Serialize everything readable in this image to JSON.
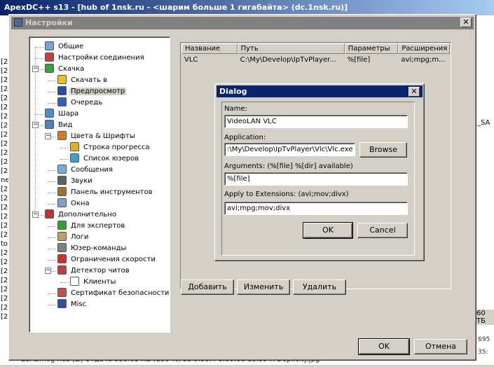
{
  "background": {
    "title": "ApexDC++ s13 - [hub of 1nsk.ru - <шарим больше 1 гигабайта> (dc.1nsk.ru)]",
    "left_marks": [
      "[2",
      "[2",
      "[2",
      "[2",
      "[2",
      "[2",
      "[2",
      "[2",
      "[2",
      "[2",
      "[2",
      "[2",
      "[2",
      "ne",
      "[2",
      "[2",
      "[2",
      "[2",
      "[2",
      "[2",
      "to",
      "[2",
      "[2",
      "[2",
      "[2",
      "[2",
      "[2",
      "[2",
      "[2"
    ],
    "right_label": "_SA",
    "right_number": "60 ТБ",
    "right_counts": [
      "695",
      "35:",
      "85"
    ],
    "bottom_text": "E3ASmog    hub    [Z] Отдача 959.05 КБ (100 %) за 0:00:4    0:00:00    18.99 К    Duplicity.jpg"
  },
  "dialog": {
    "title": "Настройки",
    "tree": [
      {
        "label": "Общие",
        "icon": "general-icon",
        "color": "#7a9fd0",
        "level": 0
      },
      {
        "label": "Настройки соединения",
        "icon": "connection-icon",
        "color": "#c04040",
        "level": 0
      },
      {
        "label": "Скачка",
        "icon": "download-icon",
        "color": "#3aa040",
        "level": 0
      },
      {
        "label": "Скачать в",
        "icon": "star-icon",
        "color": "#e8c020",
        "level": 1
      },
      {
        "label": "Предпросмотр",
        "icon": "preview-icon",
        "color": "#2050a0",
        "level": 1,
        "selected": true
      },
      {
        "label": "Очередь",
        "icon": "queue-icon",
        "color": "#3060c0",
        "level": 1
      },
      {
        "label": "Шара",
        "icon": "share-icon",
        "color": "#4a90d0",
        "level": 0
      },
      {
        "label": "Вид",
        "icon": "view-icon",
        "color": "#5080c0",
        "level": 0
      },
      {
        "label": "Цвета & Шрифты",
        "icon": "palette-icon",
        "color": "#d08020",
        "level": 1
      },
      {
        "label": "Строка прогресса",
        "icon": "progress-bar-icon",
        "color": "#e0b020",
        "level": 2
      },
      {
        "label": "Список юзеров",
        "icon": "user-list-icon",
        "color": "#40a0d0",
        "level": 2
      },
      {
        "label": "Сообщения",
        "icon": "messages-icon",
        "color": "#70b0e0",
        "level": 1
      },
      {
        "label": "Звуки",
        "icon": "sounds-icon",
        "color": "#606060",
        "level": 1
      },
      {
        "label": "Панель инструментов",
        "icon": "toolbar-icon",
        "color": "#a07030",
        "level": 1
      },
      {
        "label": "Окна",
        "icon": "windows-icon",
        "color": "#80a0d0",
        "level": 1
      },
      {
        "label": "Дополнительно",
        "icon": "advanced-icon",
        "color": "#c03030",
        "level": 0
      },
      {
        "label": "Для экспертов",
        "icon": "experts-icon",
        "color": "#30a030",
        "level": 1
      },
      {
        "label": "Логи",
        "icon": "logs-icon",
        "color": "#c0a060",
        "level": 1
      },
      {
        "label": "Юзер-команды",
        "icon": "user-commands-icon",
        "color": "#808080",
        "level": 1
      },
      {
        "label": "Ограничения скорости",
        "icon": "speed-limit-icon",
        "color": "#d03030",
        "level": 1
      },
      {
        "label": "Детектор читов",
        "icon": "cheat-detector-icon",
        "color": "#c04040",
        "level": 1
      },
      {
        "label": "Клиенты",
        "icon": "clients-icon",
        "color": "#ffffff",
        "level": 2
      },
      {
        "label": "Сертификат безопасности",
        "icon": "certificate-icon",
        "color": "#c05050",
        "level": 1
      },
      {
        "label": "Misc",
        "icon": "misc-icon",
        "color": "#3050a0",
        "level": 1
      }
    ],
    "list": {
      "columns": [
        "Название",
        "Путь",
        "Параметры",
        "Расширения"
      ],
      "rows": [
        [
          "VLC",
          "C:\\My\\Develop\\IpTvPlayer...",
          "%[file]",
          "avi;mpg;m..."
        ]
      ]
    },
    "buttons": {
      "add": "Добавить",
      "edit": "Изменить",
      "remove": "Удалить",
      "ok": "OK",
      "cancel": "Отмена"
    }
  },
  "inner_dialog": {
    "title": "Dialog",
    "name_label": "Name:",
    "name_value": "VideoLAN VLC",
    "application_label": "Application:",
    "application_value": ":\\My\\Develop\\IpTvPlayer\\Vlc\\Vlc.exe",
    "browse": "Browse",
    "arguments_label": "Arguments: (%[file] %[dir] available)",
    "arguments_value": "%[file]",
    "extensions_label": "Apply to Extensions: (avi;mov;divx)",
    "extensions_value": "avi;mpg;mov;divx",
    "ok": "OK",
    "cancel": "Cancel"
  }
}
